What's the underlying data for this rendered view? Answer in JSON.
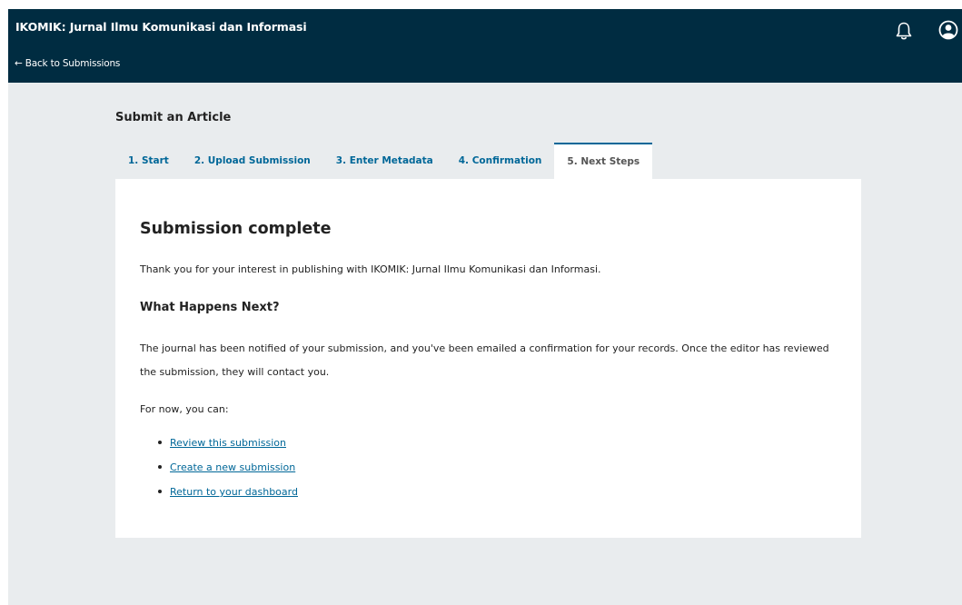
{
  "header": {
    "journal_title": "IKOMIK: Jurnal Ilmu Komunikasi dan Informasi",
    "back_link": "← Back to Submissions",
    "icons": [
      "bell-icon",
      "user-icon"
    ]
  },
  "page": {
    "title": "Submit an Article"
  },
  "tabs": [
    {
      "label": "1. Start"
    },
    {
      "label": "2. Upload Submission"
    },
    {
      "label": "3. Enter Metadata"
    },
    {
      "label": "4. Confirmation"
    },
    {
      "label": "5. Next Steps"
    }
  ],
  "panel": {
    "heading": "Submission complete",
    "thanks": "Thank you for your interest in publishing with IKOMIK: Jurnal Ilmu Komunikasi dan Informasi.",
    "subheading": "What Happens Next?",
    "notice": "The journal has been notified of your submission, and you've been emailed a confirmation for your records. Once the editor has reviewed the submission, they will contact you.",
    "for_now": "For now, you can:",
    "links": [
      {
        "label": "Review this submission"
      },
      {
        "label": "Create a new submission"
      },
      {
        "label": "Return to your dashboard"
      }
    ]
  },
  "colors": {
    "header_bg": "#002c41",
    "accent": "#006798",
    "page_bg": "#e9ecee"
  }
}
